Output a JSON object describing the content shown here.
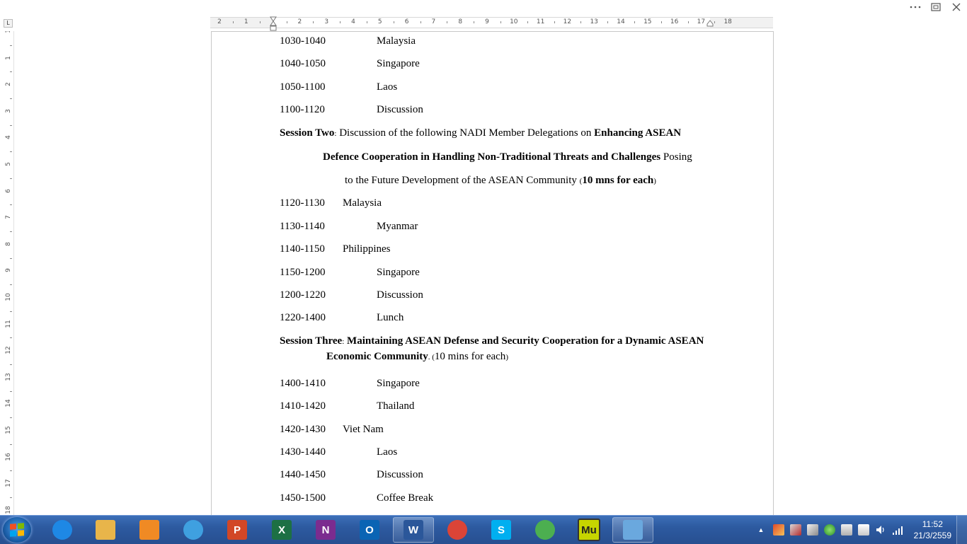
{
  "window": {
    "more_icon": "ellipsis-icon",
    "restore_icon": "restore-icon",
    "close_icon": "close-icon"
  },
  "ruler": {
    "tab_selector": "L",
    "horizontal_labels": [
      "2",
      "1",
      "1",
      "2",
      "3",
      "4",
      "5",
      "6",
      "7",
      "8",
      "9",
      "10",
      "11",
      "12",
      "13",
      "14",
      "15",
      "16",
      "17",
      "18"
    ],
    "vertical_labels": [
      "1",
      "1",
      "2",
      "3",
      "4",
      "5",
      "6",
      "7",
      "8",
      "9",
      "10",
      "11",
      "12",
      "13",
      "14",
      "15",
      "16",
      "17",
      "18"
    ]
  },
  "document": {
    "session1_rows": [
      {
        "time": "1030-1040",
        "name": "Malaysia"
      },
      {
        "time": "1040-1050",
        "name": "Singapore"
      },
      {
        "time": "1050-1100",
        "name": "Laos"
      },
      {
        "time": "1100-1120",
        "name": "Discussion"
      }
    ],
    "session2": {
      "label": "Session Two",
      "colon": ":",
      "intro": " Discussion of the following NADI Member Delegations on ",
      "bold1": "Enhancing ASEAN",
      "line2_bold": "Defence Cooperation in Handling Non-Traditional Threats and Challenges",
      "line2_rest": " Posing",
      "line3_pre": "to the Future Development of the ASEAN Community ",
      "line3_paren_open": "(",
      "line3_bold": "10 mns for each",
      "line3_paren_close": ")"
    },
    "session2_rows": [
      {
        "time": "1120-1130",
        "name": "Malaysia"
      },
      {
        "time": "1130-1140",
        "name": "Myanmar"
      },
      {
        "time": "1140-1150",
        "name": "Philippines"
      },
      {
        "time": "1150-1200",
        "name": "Singapore"
      },
      {
        "time": "1200-1220",
        "name": "Discussion"
      },
      {
        "time": "1220-1400",
        "name": "Lunch"
      }
    ],
    "session3": {
      "label": "Session Three",
      "colon": ":",
      "bold1": " Maintaining ASEAN Defense and Security Cooperation for a Dynamic ASEAN",
      "line2_bold": "Economic Community",
      "line2_dot": ".",
      "line2_paren_open": " (",
      "line2_text": "10 mins for each",
      "line2_paren_close": ")"
    },
    "session3_rows": [
      {
        "time": "1400-1410",
        "name": "Singapore"
      },
      {
        "time": "1410-1420",
        "name": "Thailand"
      },
      {
        "time": "1420-1430",
        "name": "Viet Nam"
      },
      {
        "time": "1430-1440",
        "name": "Laos"
      },
      {
        "time": "1440-1450",
        "name": "Discussion"
      },
      {
        "time": "1450-1500",
        "name": "Coffee Break"
      }
    ]
  },
  "taskbar": {
    "pinned": [
      {
        "name": "Internet Explorer",
        "icon": "internet-explorer-icon",
        "color": "#1e88e5"
      },
      {
        "name": "File Explorer",
        "icon": "folder-icon",
        "color": "#e8b54a"
      },
      {
        "name": "Media Player",
        "icon": "media-player-icon",
        "color": "#f08a24"
      },
      {
        "name": "Browser",
        "icon": "globe-swirl-icon",
        "color": "#3fa0e0"
      },
      {
        "name": "PowerPoint",
        "icon": "powerpoint-icon",
        "color": "#d24726",
        "letter": "P"
      },
      {
        "name": "Excel",
        "icon": "excel-icon",
        "color": "#1d7044",
        "letter": "X"
      },
      {
        "name": "OneNote",
        "icon": "onenote-icon",
        "color": "#7b2c8f",
        "letter": "N"
      },
      {
        "name": "Outlook",
        "icon": "outlook-icon",
        "color": "#0a64b4",
        "letter": "O"
      },
      {
        "name": "Word",
        "icon": "word-icon",
        "color": "#2b579a",
        "letter": "W"
      },
      {
        "name": "Chrome",
        "icon": "chrome-icon",
        "color": "#db4437"
      },
      {
        "name": "Skype",
        "icon": "skype-icon",
        "color": "#00aff0",
        "letter": "S"
      },
      {
        "name": "Messenger",
        "icon": "messenger-icon",
        "color": "#4caf50"
      },
      {
        "name": "Muse",
        "icon": "muse-icon",
        "color": "#c6d400",
        "letter": "Mu"
      },
      {
        "name": "Control Panel",
        "icon": "control-panel-icon",
        "color": "#6aa8de"
      }
    ],
    "tray_icons": [
      "show-hidden-icons-icon",
      "flag-alert-icon",
      "network-alert-icon",
      "tools-icon",
      "green-sync-icon",
      "drive-icon",
      "usb-icon",
      "volume-icon",
      "signal-icon"
    ],
    "clock_time": "11:52",
    "clock_date": "21/3/2559"
  }
}
